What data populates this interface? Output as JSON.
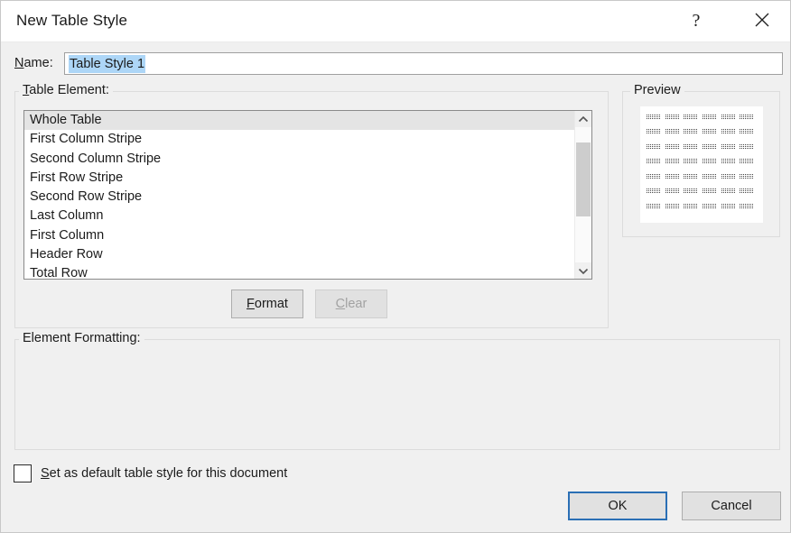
{
  "window": {
    "title": "New Table Style",
    "help_icon": "question-mark-icon",
    "close_icon": "close-icon"
  },
  "name_field": {
    "label_prefix": "",
    "label_accel": "N",
    "label_rest": "ame:",
    "value": "Table Style 1",
    "placeholder": "",
    "selection_color": "#add6f7"
  },
  "table_element_group": {
    "label_accel": "T",
    "label_rest": "able Element:",
    "items": [
      "Whole Table",
      "First Column Stripe",
      "Second Column Stripe",
      "First Row Stripe",
      "Second Row Stripe",
      "Last Column",
      "First Column",
      "Header Row",
      "Total Row"
    ],
    "selected_index": 0,
    "scrollbar": {
      "up_icon": "chevron-up-icon",
      "down_icon": "chevron-down-icon",
      "thumb_top_pct": 11,
      "thumb_height_pct": 55
    },
    "buttons": {
      "format": {
        "accel": "F",
        "rest": "ormat",
        "enabled": true
      },
      "clear": {
        "accel": "C",
        "rest": "lear",
        "enabled": false
      }
    }
  },
  "preview_group": {
    "label": "Preview",
    "grid": {
      "rows": 7,
      "cols": 6
    }
  },
  "element_formatting_group": {
    "label": "Element Formatting:",
    "content": ""
  },
  "default_checkbox": {
    "checked": false,
    "label_accel": "S",
    "label_rest": "et as default table style for this document"
  },
  "footer": {
    "ok_label": "OK",
    "cancel_label": "Cancel",
    "default_button": "ok",
    "focus_color": "#2a6fb5"
  }
}
